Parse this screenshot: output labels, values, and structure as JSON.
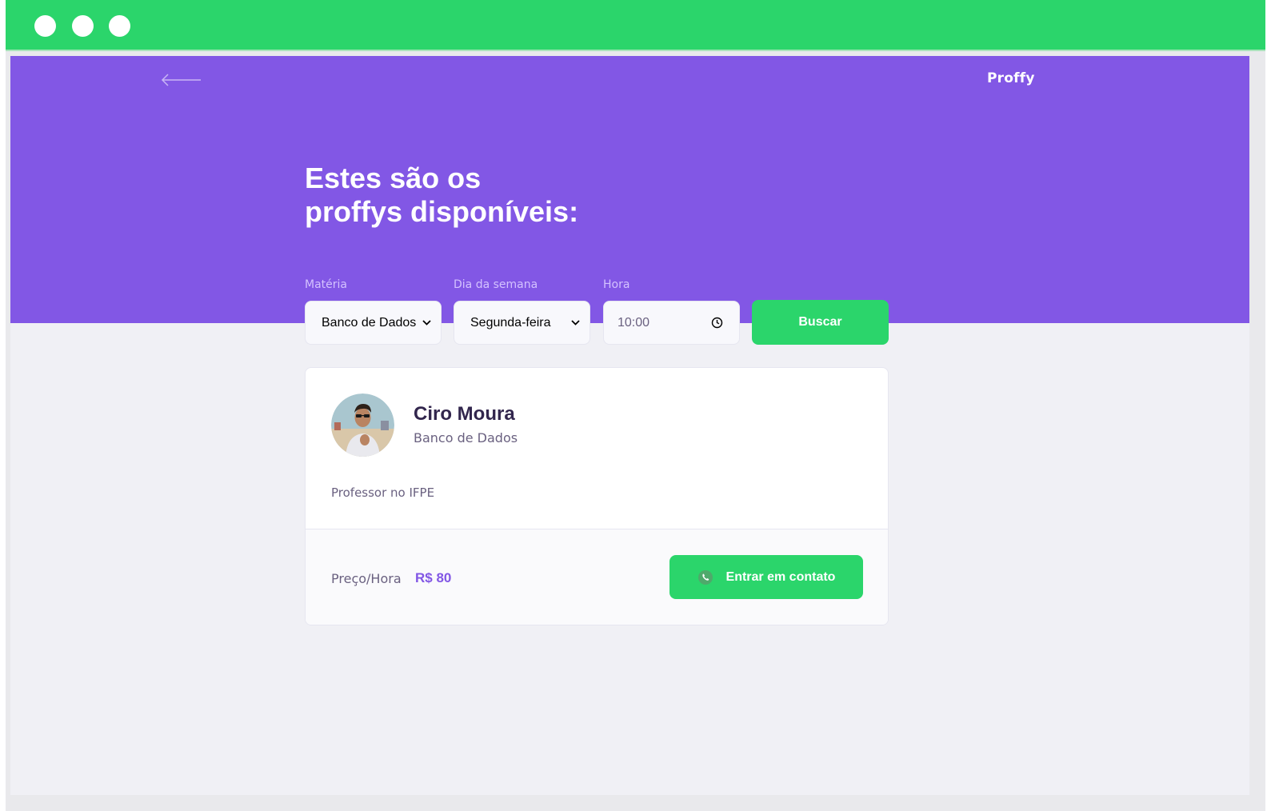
{
  "window": {
    "controls": [
      "close",
      "minimize",
      "maximize"
    ]
  },
  "header": {
    "back_icon": "arrow-left-icon",
    "logo": "Proffy"
  },
  "hero": {
    "title_line1": "Estes são os",
    "title_line2": "proffys disponíveis:"
  },
  "filters": {
    "materia": {
      "label": "Matéria",
      "value": "Banco de Dados"
    },
    "dia": {
      "label": "Dia da semana",
      "value": "Segunda-feira"
    },
    "hora": {
      "label": "Hora",
      "value": "10:00"
    },
    "search_button": "Buscar"
  },
  "teacher": {
    "name": "Ciro Moura",
    "subject": "Banco de Dados",
    "bio": "Professor no IFPE",
    "price_label": "Preço/Hora",
    "price_value": "R$ 80",
    "contact_button": "Entrar em contato"
  },
  "colors": {
    "primary": "#8257e5",
    "secondary": "#2bd56b",
    "background": "#f0f0f5",
    "title_text": "#32264d",
    "body_text": "#6a6180"
  }
}
